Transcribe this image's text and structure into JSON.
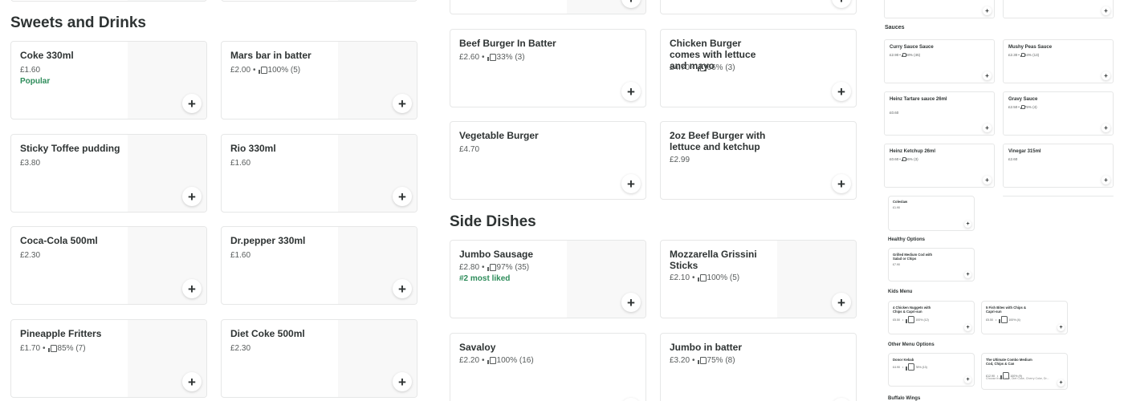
{
  "sweets": {
    "title": "Sweets and Drinks",
    "items": [
      {
        "name": "Coke 330ml",
        "price": "£1.60",
        "badge": "Popular"
      },
      {
        "name": "Mars bar in batter",
        "price": "£2.00",
        "rating": "100% (5)"
      },
      {
        "name": "Sticky Toffee pudding",
        "price": "£3.80"
      },
      {
        "name": "Rio 330ml",
        "price": "£1.60"
      },
      {
        "name": " Coca-Cola 500ml",
        "price": "£2.30"
      },
      {
        "name": "Dr.pepper 330ml",
        "price": "£1.60"
      },
      {
        "name": "Pineapple Fritters",
        "price": "£1.70",
        "rating": "85% (7)"
      },
      {
        "name": "Diet Coke 500ml",
        "price": "£2.30"
      }
    ]
  },
  "burgers": {
    "items": [
      {
        "name": "Beef Burger In Batter",
        "price": "£2.60",
        "rating": "33% (3)"
      },
      {
        "name": "Chicken Burger comes with lettuce and mayo",
        "price": "£4.70",
        "rating": "66% (3)"
      },
      {
        "name": "Vegetable Burger",
        "price": "£4.70"
      },
      {
        "name": "2oz Beef Burger with lettuce and ketchup",
        "price": "£2.99"
      }
    ]
  },
  "sides": {
    "title": "Side Dishes",
    "items": [
      {
        "name": "Jumbo Sausage",
        "price": "£2.80",
        "rating": "97% (35)",
        "badge": "#2 most liked"
      },
      {
        "name": "Mozzarella Grissini Sticks",
        "price": "£2.10",
        "rating": "100% (5)"
      },
      {
        "name": "Savaloy",
        "price": "£2.20",
        "rating": "100% (16)"
      },
      {
        "name": "Jumbo  in batter",
        "price": "£3.20",
        "rating": "75% (8)"
      }
    ]
  },
  "sauces": {
    "title": "Sauces",
    "items": [
      {
        "name": "Curry Sauce Sauce",
        "price": "£2.90",
        "rating": "88% (45)"
      },
      {
        "name": "Mushy Peas Sauce",
        "price": "£2.30",
        "rating": "84% (13)"
      },
      {
        "name": "Heinz Tartare sauce 26ml",
        "price": "£0.60"
      },
      {
        "name": "Gravy Sauce",
        "price": "£2.50",
        "rating": "75% (4)"
      },
      {
        "name": "Heinz Ketchup  26ml",
        "price": "£0.60",
        "rating": "66% (3)"
      },
      {
        "name": "Vinegar  315ml",
        "price": "£2.60"
      }
    ]
  },
  "coleslaw": {
    "name": "Coleslaw",
    "price": "£1.90"
  },
  "healthy": {
    "title": "Healthy Options",
    "items": [
      {
        "name": "Grilled Medium Cod with Salad or Chips",
        "price": "£7.90"
      }
    ]
  },
  "kids": {
    "title": "Kids Menu",
    "items": [
      {
        "name": "4 Chicken Nuggets with Chips & Capri-sun",
        "price": "£5.50",
        "rating": "100% (12)"
      },
      {
        "name": "5 Fish Bites with Chips & Capri-sun",
        "price": "£5.50",
        "rating": "100% (4)"
      }
    ]
  },
  "other": {
    "title": "Other Menu Options",
    "items": [
      {
        "name": "Donor Kebab",
        "price": "£4.90",
        "rating": "78% (13)"
      },
      {
        "name": "The Ultimate Combo Medium Cod, Chips & Can",
        "price": "£12.90",
        "rating": "100% (9)",
        "desc": "Choose from Coke, Diet Coke, Cherry Coke, Dr..."
      }
    ]
  },
  "buffalo": {
    "title": "Buffalo Wings"
  },
  "ui": {
    "add_symbol": "+"
  }
}
